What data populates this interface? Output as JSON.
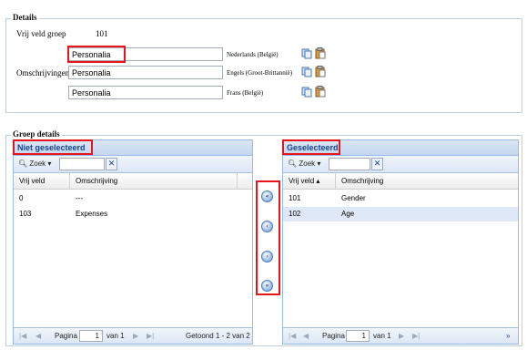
{
  "details": {
    "legend": "Details",
    "group_label": "Vrij veld groep",
    "group_value": "101",
    "desc_label": "Omschrijvingen",
    "rows": [
      {
        "value": "Personalia",
        "lang": "Nederlands (België)"
      },
      {
        "value": "Personalia",
        "lang": "Engels (Groot-Brittannië)"
      },
      {
        "value": "Personalia",
        "lang": "Frans (België)"
      }
    ]
  },
  "groep": {
    "legend": "Groep details",
    "left": {
      "title": "Niet geselecteerd",
      "zoek": "Zoek",
      "col1": "Vrij veld",
      "col2": "Omschrijving",
      "rows": [
        {
          "id": "0",
          "desc": "---"
        },
        {
          "id": "103",
          "desc": "Expenses"
        }
      ],
      "paging_label": "Pagina",
      "page": "1",
      "of": "van 1",
      "shown": "Getoond 1 - 2 van 2"
    },
    "right": {
      "title": "Geselecteerd",
      "zoek": "Zoek",
      "col1": "Vrij veld",
      "col2": "Omschrijving",
      "rows": [
        {
          "id": "101",
          "desc": "Gender"
        },
        {
          "id": "102",
          "desc": "Age"
        }
      ],
      "paging_label": "Pagina",
      "page": "1",
      "of": "van 1"
    },
    "move_buttons": [
      "«",
      "‹",
      "›",
      "»"
    ]
  },
  "colors": {
    "highlight": "#e8141c",
    "panel_title": "#15428b",
    "selected_row": "#dfe8f6"
  }
}
